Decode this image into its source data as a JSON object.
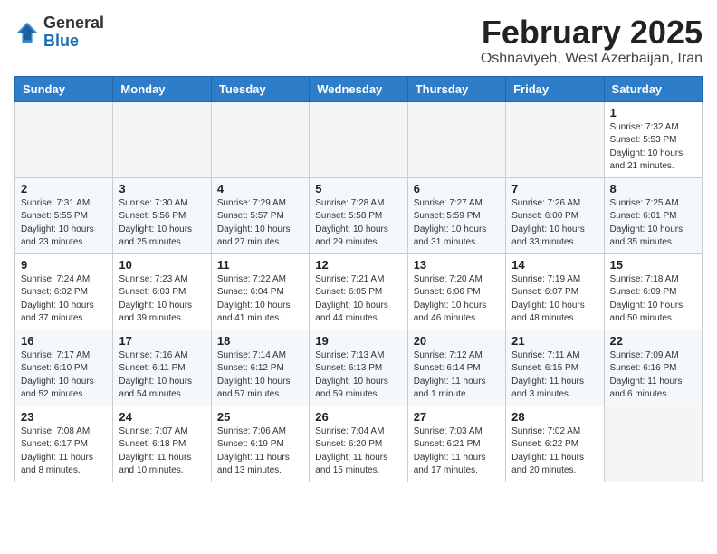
{
  "header": {
    "logo_line1": "General",
    "logo_line2": "Blue",
    "month_year": "February 2025",
    "location": "Oshnaviyeh, West Azerbaijan, Iran"
  },
  "weekdays": [
    "Sunday",
    "Monday",
    "Tuesday",
    "Wednesday",
    "Thursday",
    "Friday",
    "Saturday"
  ],
  "weeks": [
    {
      "days": [
        {
          "num": "",
          "info": ""
        },
        {
          "num": "",
          "info": ""
        },
        {
          "num": "",
          "info": ""
        },
        {
          "num": "",
          "info": ""
        },
        {
          "num": "",
          "info": ""
        },
        {
          "num": "",
          "info": ""
        },
        {
          "num": "1",
          "info": "Sunrise: 7:32 AM\nSunset: 5:53 PM\nDaylight: 10 hours\nand 21 minutes."
        }
      ]
    },
    {
      "days": [
        {
          "num": "2",
          "info": "Sunrise: 7:31 AM\nSunset: 5:55 PM\nDaylight: 10 hours\nand 23 minutes."
        },
        {
          "num": "3",
          "info": "Sunrise: 7:30 AM\nSunset: 5:56 PM\nDaylight: 10 hours\nand 25 minutes."
        },
        {
          "num": "4",
          "info": "Sunrise: 7:29 AM\nSunset: 5:57 PM\nDaylight: 10 hours\nand 27 minutes."
        },
        {
          "num": "5",
          "info": "Sunrise: 7:28 AM\nSunset: 5:58 PM\nDaylight: 10 hours\nand 29 minutes."
        },
        {
          "num": "6",
          "info": "Sunrise: 7:27 AM\nSunset: 5:59 PM\nDaylight: 10 hours\nand 31 minutes."
        },
        {
          "num": "7",
          "info": "Sunrise: 7:26 AM\nSunset: 6:00 PM\nDaylight: 10 hours\nand 33 minutes."
        },
        {
          "num": "8",
          "info": "Sunrise: 7:25 AM\nSunset: 6:01 PM\nDaylight: 10 hours\nand 35 minutes."
        }
      ]
    },
    {
      "days": [
        {
          "num": "9",
          "info": "Sunrise: 7:24 AM\nSunset: 6:02 PM\nDaylight: 10 hours\nand 37 minutes."
        },
        {
          "num": "10",
          "info": "Sunrise: 7:23 AM\nSunset: 6:03 PM\nDaylight: 10 hours\nand 39 minutes."
        },
        {
          "num": "11",
          "info": "Sunrise: 7:22 AM\nSunset: 6:04 PM\nDaylight: 10 hours\nand 41 minutes."
        },
        {
          "num": "12",
          "info": "Sunrise: 7:21 AM\nSunset: 6:05 PM\nDaylight: 10 hours\nand 44 minutes."
        },
        {
          "num": "13",
          "info": "Sunrise: 7:20 AM\nSunset: 6:06 PM\nDaylight: 10 hours\nand 46 minutes."
        },
        {
          "num": "14",
          "info": "Sunrise: 7:19 AM\nSunset: 6:07 PM\nDaylight: 10 hours\nand 48 minutes."
        },
        {
          "num": "15",
          "info": "Sunrise: 7:18 AM\nSunset: 6:09 PM\nDaylight: 10 hours\nand 50 minutes."
        }
      ]
    },
    {
      "days": [
        {
          "num": "16",
          "info": "Sunrise: 7:17 AM\nSunset: 6:10 PM\nDaylight: 10 hours\nand 52 minutes."
        },
        {
          "num": "17",
          "info": "Sunrise: 7:16 AM\nSunset: 6:11 PM\nDaylight: 10 hours\nand 54 minutes."
        },
        {
          "num": "18",
          "info": "Sunrise: 7:14 AM\nSunset: 6:12 PM\nDaylight: 10 hours\nand 57 minutes."
        },
        {
          "num": "19",
          "info": "Sunrise: 7:13 AM\nSunset: 6:13 PM\nDaylight: 10 hours\nand 59 minutes."
        },
        {
          "num": "20",
          "info": "Sunrise: 7:12 AM\nSunset: 6:14 PM\nDaylight: 11 hours\nand 1 minute."
        },
        {
          "num": "21",
          "info": "Sunrise: 7:11 AM\nSunset: 6:15 PM\nDaylight: 11 hours\nand 3 minutes."
        },
        {
          "num": "22",
          "info": "Sunrise: 7:09 AM\nSunset: 6:16 PM\nDaylight: 11 hours\nand 6 minutes."
        }
      ]
    },
    {
      "days": [
        {
          "num": "23",
          "info": "Sunrise: 7:08 AM\nSunset: 6:17 PM\nDaylight: 11 hours\nand 8 minutes."
        },
        {
          "num": "24",
          "info": "Sunrise: 7:07 AM\nSunset: 6:18 PM\nDaylight: 11 hours\nand 10 minutes."
        },
        {
          "num": "25",
          "info": "Sunrise: 7:06 AM\nSunset: 6:19 PM\nDaylight: 11 hours\nand 13 minutes."
        },
        {
          "num": "26",
          "info": "Sunrise: 7:04 AM\nSunset: 6:20 PM\nDaylight: 11 hours\nand 15 minutes."
        },
        {
          "num": "27",
          "info": "Sunrise: 7:03 AM\nSunset: 6:21 PM\nDaylight: 11 hours\nand 17 minutes."
        },
        {
          "num": "28",
          "info": "Sunrise: 7:02 AM\nSunset: 6:22 PM\nDaylight: 11 hours\nand 20 minutes."
        },
        {
          "num": "",
          "info": ""
        }
      ]
    }
  ]
}
